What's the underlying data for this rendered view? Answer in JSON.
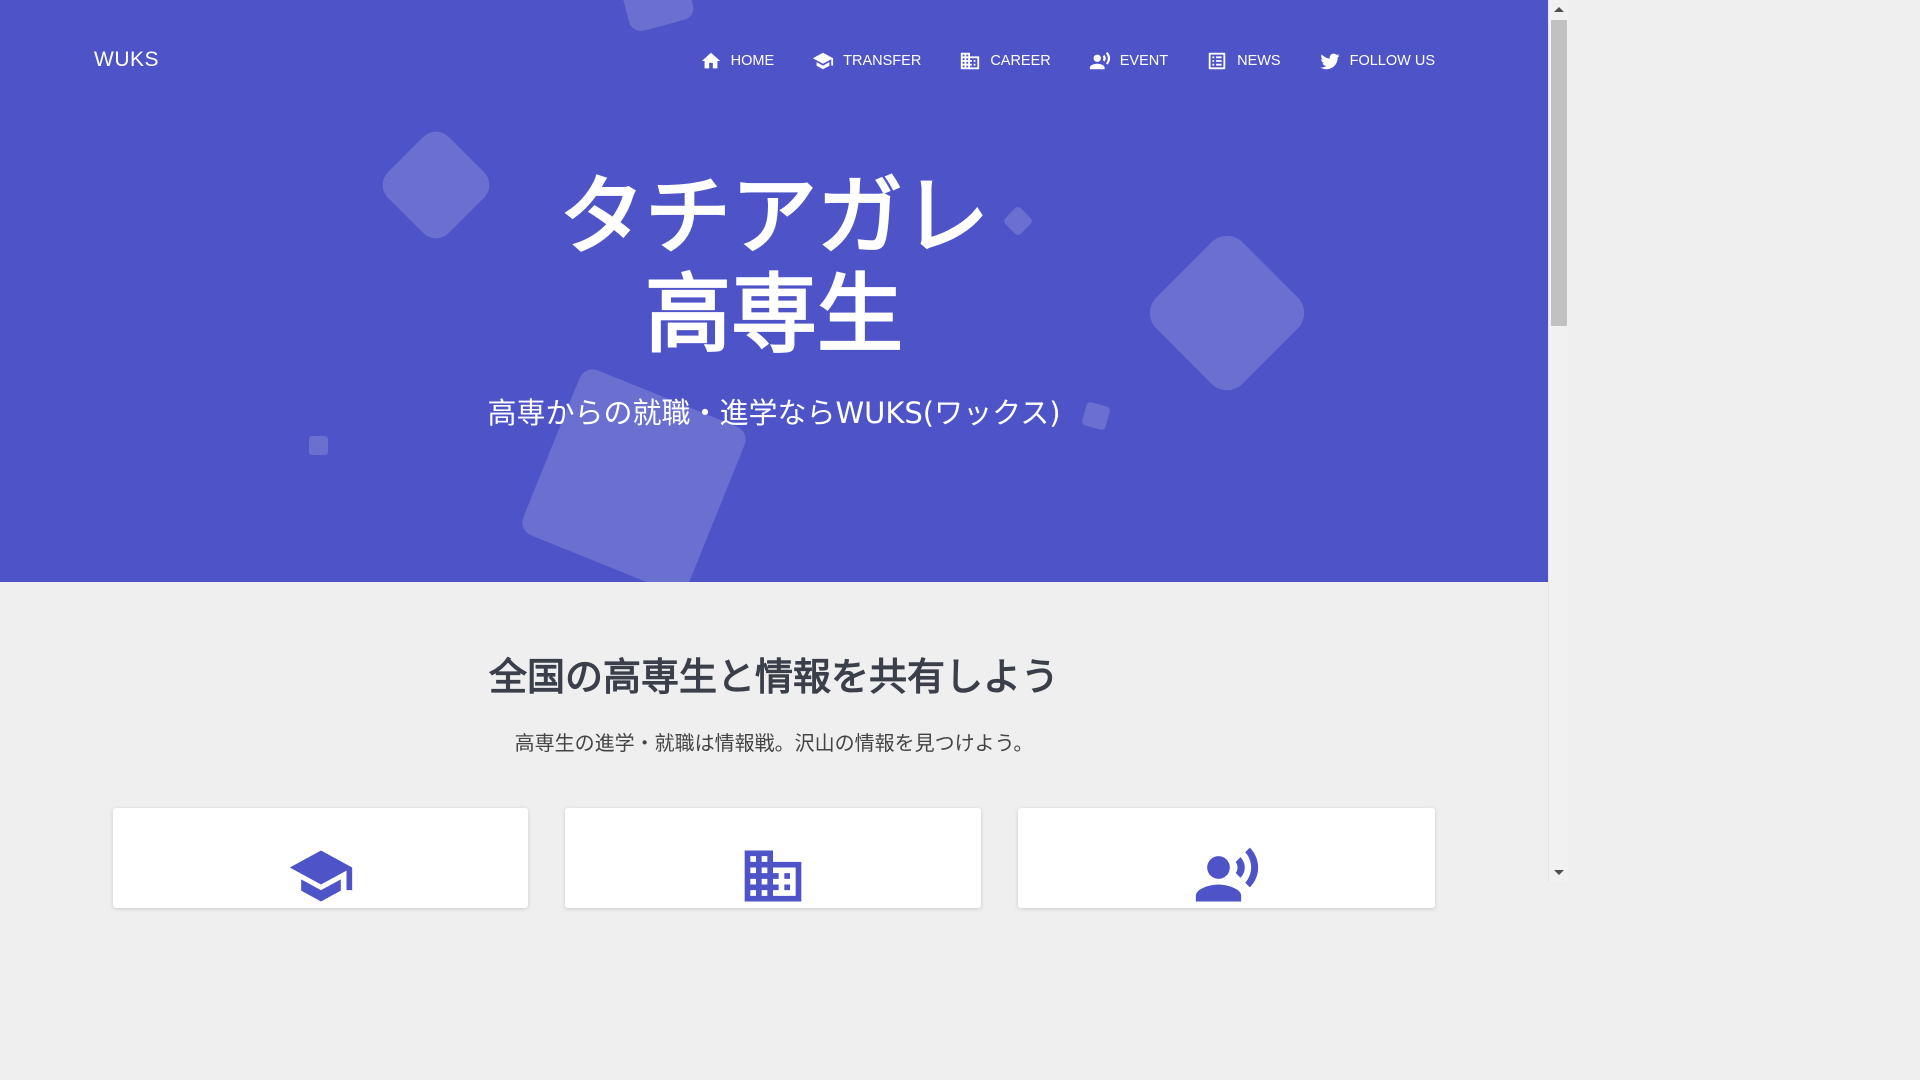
{
  "brand": "WUKS",
  "nav": {
    "items": [
      {
        "label": "HOME",
        "icon": "home-icon"
      },
      {
        "label": "TRANSFER",
        "icon": "graduation-cap-icon"
      },
      {
        "label": "CAREER",
        "icon": "building-icon"
      },
      {
        "label": "EVENT",
        "icon": "record-voice-icon"
      },
      {
        "label": "NEWS",
        "icon": "list-icon"
      },
      {
        "label": "FOLLOW US",
        "icon": "twitter-icon"
      }
    ]
  },
  "hero": {
    "title_line1": "タチアガレ",
    "title_line2": "高専生",
    "subtitle": "高専からの就職・進学ならWUKS(ワックス)",
    "background_color": "#4e54c8"
  },
  "section": {
    "title": "全国の高専生と情報を共有しよう",
    "subtitle": "高専生の進学・就職は情報戦。沢山の情報を見つけよう。"
  },
  "cards": [
    {
      "icon": "graduation-cap-icon"
    },
    {
      "icon": "building-icon"
    },
    {
      "icon": "record-voice-icon"
    }
  ]
}
